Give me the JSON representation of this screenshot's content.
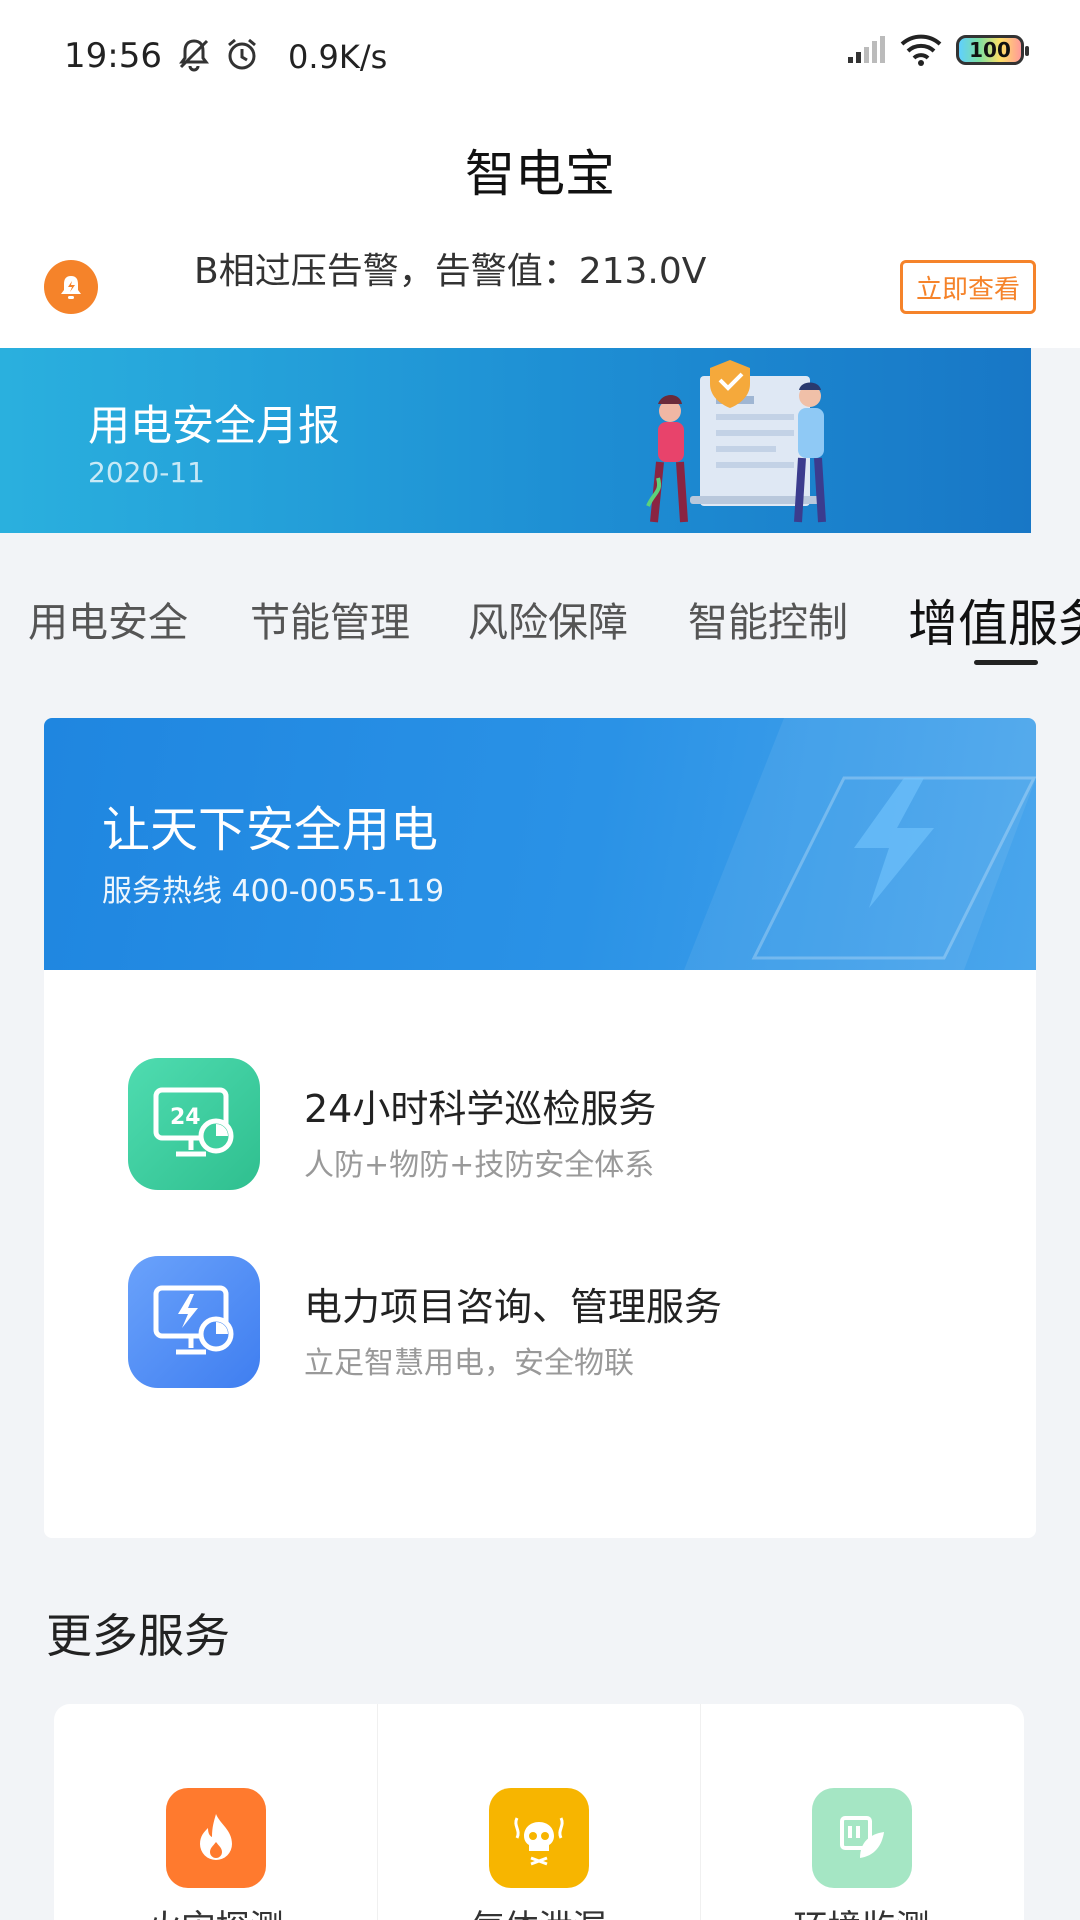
{
  "status_bar": {
    "time": "19:56",
    "net_speed": "0.9K/s",
    "battery": "100"
  },
  "app": {
    "title": "智电宝"
  },
  "alert": {
    "message": "B相过压告警，告警值：213.0V",
    "action": "立即查看",
    "accent": "#f5832a"
  },
  "banner": {
    "title": "用电安全月报",
    "date": "2020-11"
  },
  "tabs": [
    {
      "label": "用电安全"
    },
    {
      "label": "节能管理"
    },
    {
      "label": "风险保障"
    },
    {
      "label": "智能控制"
    },
    {
      "label": "增值服务",
      "active": true
    }
  ],
  "hero": {
    "title": "让天下安全用电",
    "hotline": "服务热线 400-0055-119"
  },
  "services": [
    {
      "title": "24小时科学巡检服务",
      "subtitle": "人防+物防+技防安全体系",
      "icon": "monitor-24h-icon",
      "color": "#3fcf9f"
    },
    {
      "title": "电力项目咨询、管理服务",
      "subtitle": "立足智慧用电，安全物联",
      "icon": "monitor-bolt-icon",
      "color": "#4f8df5"
    }
  ],
  "more": {
    "title": "更多服务",
    "items": [
      {
        "label": "火灾探测",
        "icon": "fire-icon",
        "color": "#ff7a2e"
      },
      {
        "label": "气体泄漏",
        "icon": "gas-skull-icon",
        "color": "#f7b500"
      },
      {
        "label": "环境监测",
        "icon": "leaf-icon",
        "color": "#a5e6c4"
      }
    ]
  }
}
